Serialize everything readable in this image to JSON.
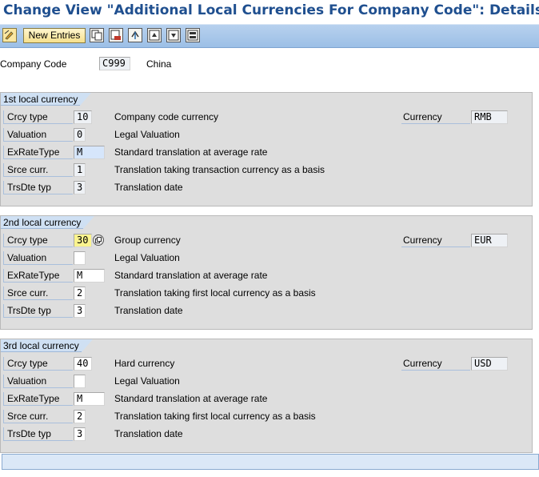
{
  "window": {
    "title": "Change View \"Additional Local Currencies For Company Code\": Details"
  },
  "toolbar": {
    "new_entries_label": "New Entries",
    "icons": [
      "edit-toggle-icon",
      "copy-icon",
      "delete-icon",
      "undo-icon",
      "previous-entry-icon",
      "next-entry-icon",
      "select-all-icon"
    ]
  },
  "header": {
    "company_code_label": "Company Code",
    "company_code_value": "C999",
    "company_name": "China"
  },
  "groups": [
    {
      "title": "1st local currency",
      "crcy_type_label": "Crcy type",
      "crcy_type_value": "10",
      "crcy_type_desc": "Company code currency",
      "currency_label": "Currency",
      "currency_value": "RMB",
      "valuation_label": "Valuation",
      "valuation_value": "0",
      "valuation_desc": "Legal Valuation",
      "exratetype_label": "ExRateType",
      "exratetype_value": "M",
      "exratetype_desc": "Standard translation at average rate",
      "srce_label": "Srce curr.",
      "srce_value": "1",
      "srce_desc": "Translation taking transaction currency as a basis",
      "trsdte_label": "TrsDte typ",
      "trsdte_value": "3",
      "trsdte_desc": "Translation date"
    },
    {
      "title": "2nd local currency",
      "crcy_type_label": "Crcy type",
      "crcy_type_value": "30",
      "crcy_type_desc": "Group currency",
      "currency_label": "Currency",
      "currency_value": "EUR",
      "valuation_label": "Valuation",
      "valuation_value": "",
      "valuation_desc": "Legal Valuation",
      "exratetype_label": "ExRateType",
      "exratetype_value": "M",
      "exratetype_desc": "Standard translation at average rate",
      "srce_label": "Srce curr.",
      "srce_value": "2",
      "srce_desc": "Translation taking first local currency as a basis",
      "trsdte_label": "TrsDte typ",
      "trsdte_value": "3",
      "trsdte_desc": "Translation date"
    },
    {
      "title": "3rd local currency",
      "crcy_type_label": "Crcy type",
      "crcy_type_value": "40",
      "crcy_type_desc": "Hard currency",
      "currency_label": "Currency",
      "currency_value": "USD",
      "valuation_label": "Valuation",
      "valuation_value": "",
      "valuation_desc": "Legal Valuation",
      "exratetype_label": "ExRateType",
      "exratetype_value": "M",
      "exratetype_desc": "Standard translation at average rate",
      "srce_label": "Srce curr.",
      "srce_value": "2",
      "srce_desc": "Translation taking first local currency as a basis",
      "trsdte_label": "TrsDte typ",
      "trsdte_value": "3",
      "trsdte_desc": "Translation date"
    }
  ],
  "colors": {
    "title": "#1f4f8f",
    "toolbar": "#a9c8ec",
    "group_bg": "#dedede",
    "focus_field": "#fbf48e"
  }
}
